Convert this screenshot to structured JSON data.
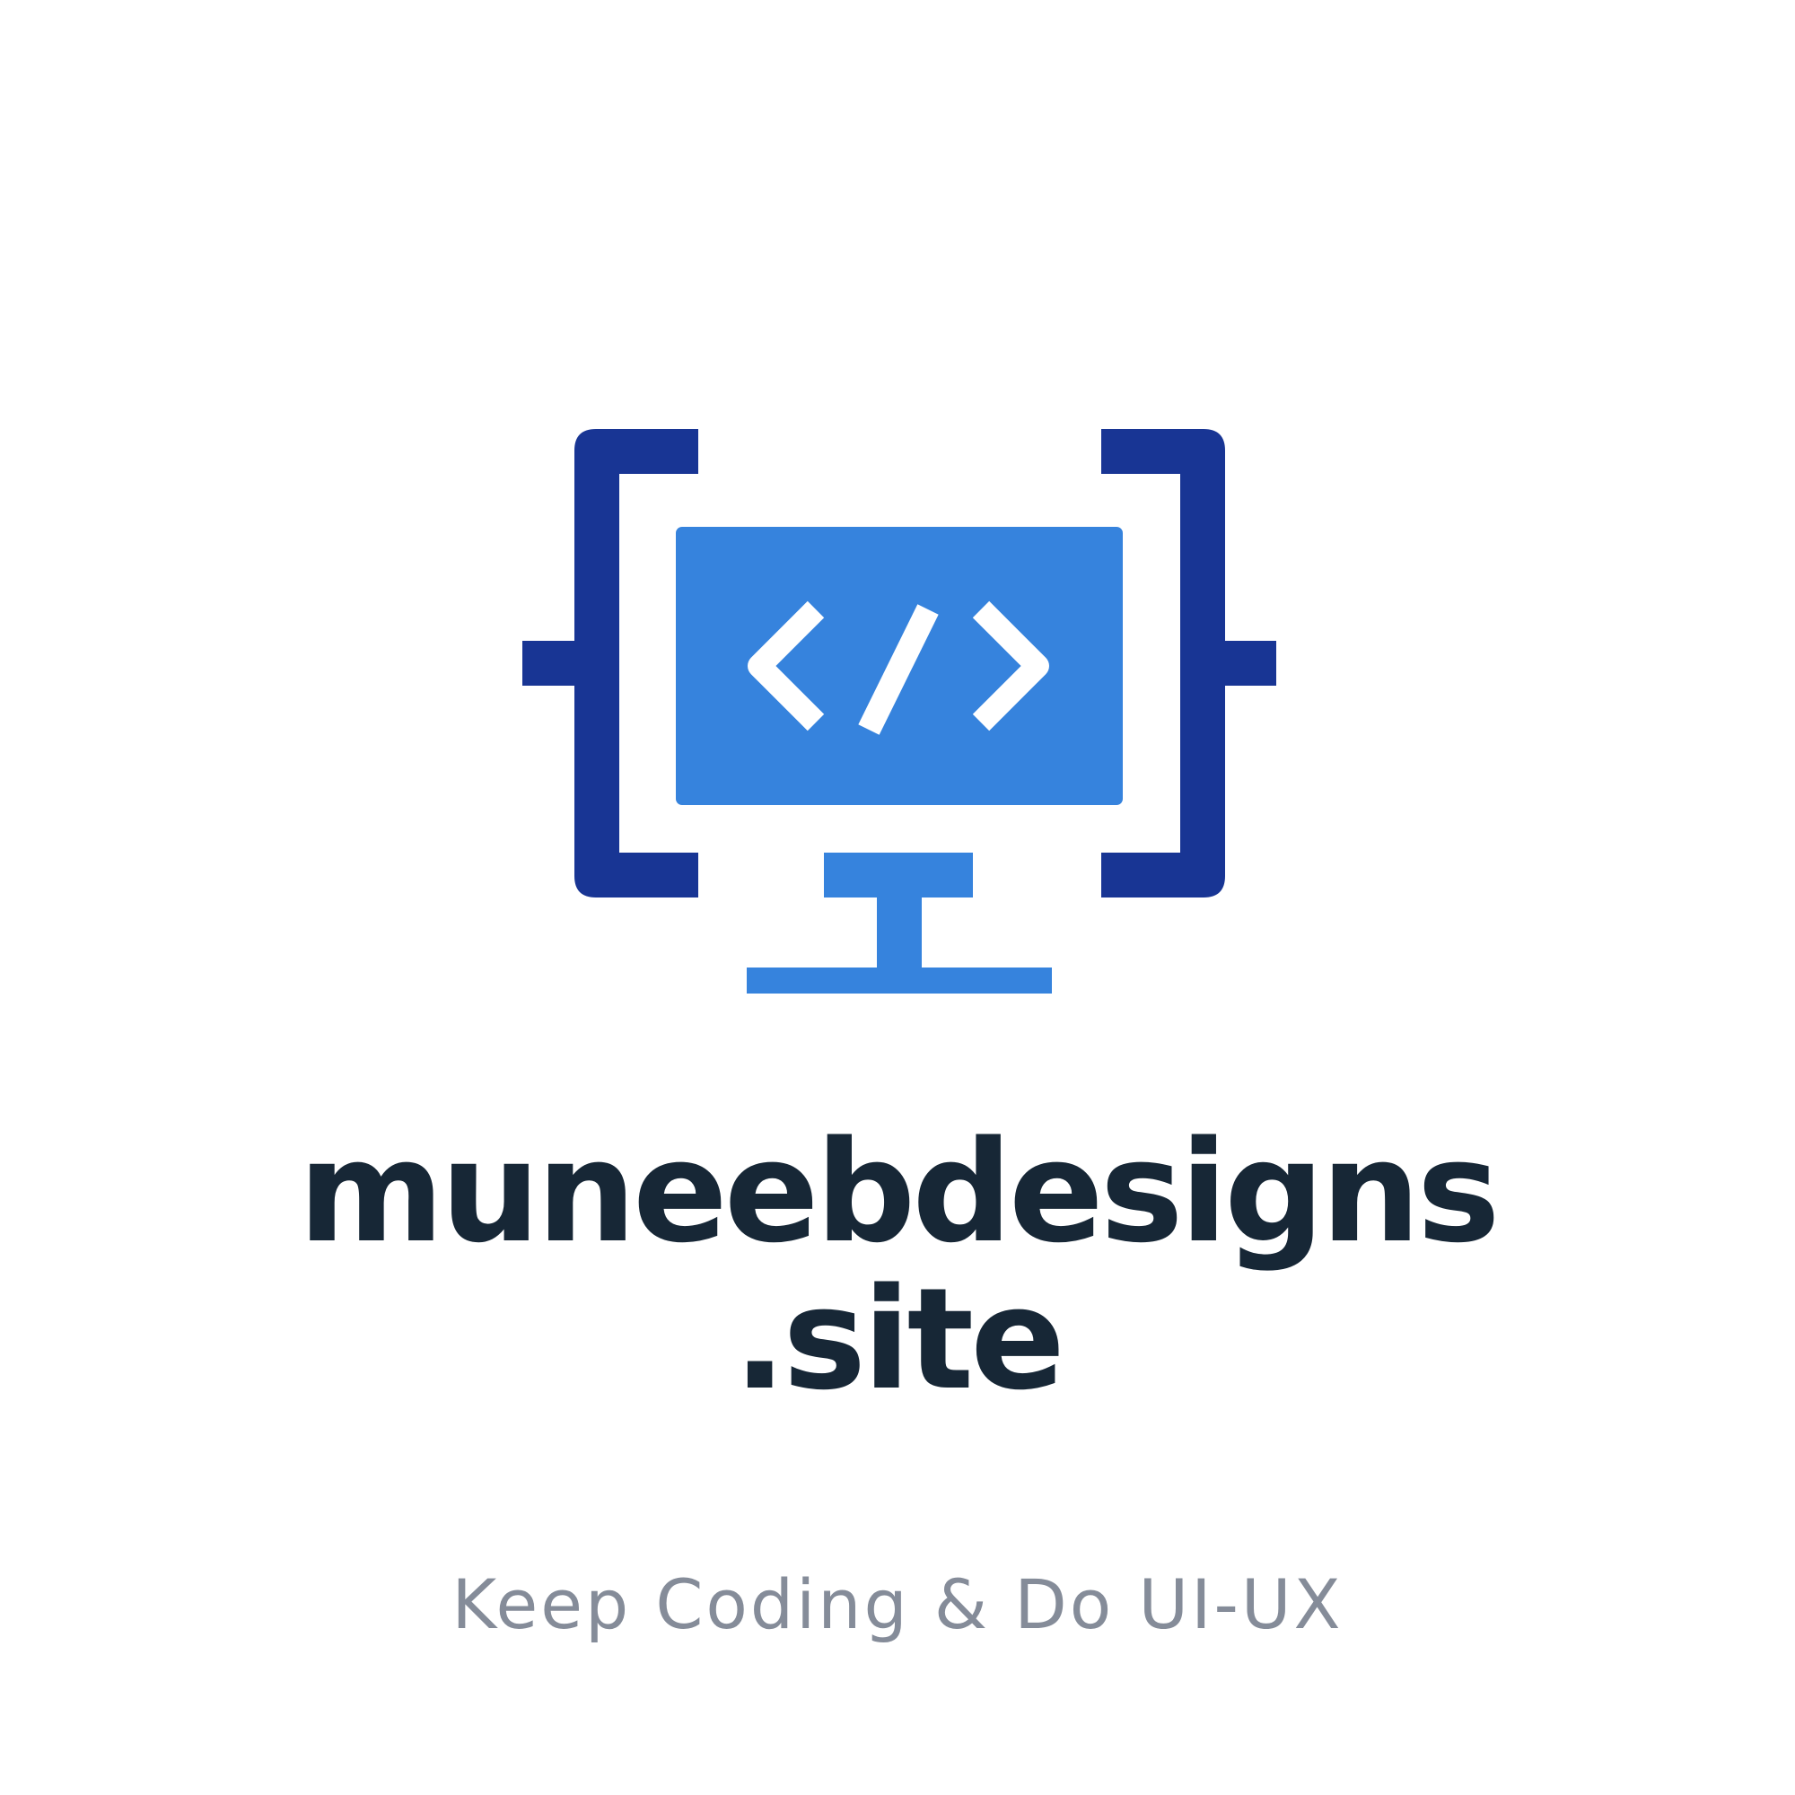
{
  "logo": {
    "icon": "monitor-code-icon",
    "bracket_color": "#183594",
    "screen_color": "#3683dd",
    "glyph_color": "#ffffff"
  },
  "brand": {
    "name_line_1": "muneebdesigns",
    "name_line_2": ".site",
    "text_color": "#172736"
  },
  "tagline": {
    "text": "Keep Coding & Do UI-UX",
    "color": "#858c99"
  }
}
